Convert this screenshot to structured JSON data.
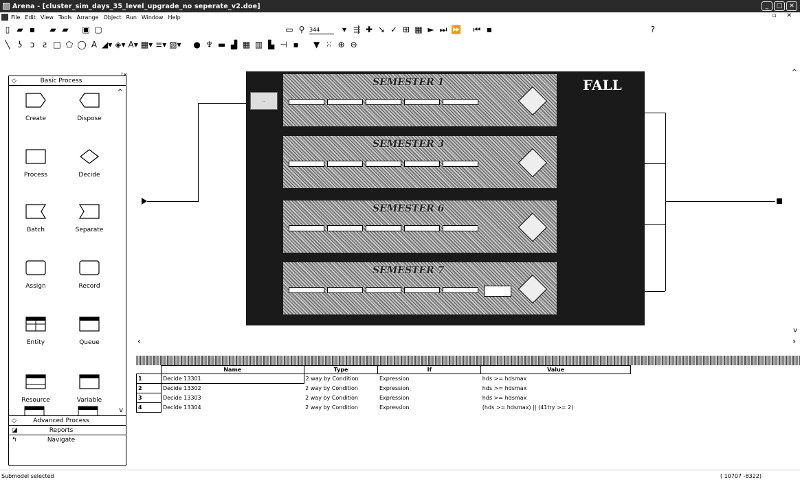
{
  "window": {
    "title": "Arena - [cluster_sim_days_35_level_upgrade_no seperate_v2.doe]"
  },
  "menubar": {
    "items": [
      "File",
      "Edit",
      "View",
      "Tools",
      "Arrange",
      "Object",
      "Run",
      "Window",
      "Help"
    ]
  },
  "toolbar": {
    "zoom_value": "344"
  },
  "project_bar": {
    "basic_process_label": "Basic Process",
    "modules": [
      {
        "label": "Create"
      },
      {
        "label": "Dispose"
      },
      {
        "label": "Process"
      },
      {
        "label": "Decide"
      },
      {
        "label": "Batch"
      },
      {
        "label": "Separate"
      },
      {
        "label": "Assign"
      },
      {
        "label": "Record"
      },
      {
        "label": "Entity"
      },
      {
        "label": "Queue"
      },
      {
        "label": "Resource"
      },
      {
        "label": "Variable"
      }
    ],
    "advanced_process_label": "Advanced Process",
    "reports_label": "Reports",
    "navigate_label": "Navigate"
  },
  "canvas": {
    "submodel_label": "FALL",
    "semesters": [
      {
        "title": "SEMESTER 1"
      },
      {
        "title": "SEMESTER 3"
      },
      {
        "title": "SEMESTER 6"
      },
      {
        "title": "SEMESTER 7"
      }
    ]
  },
  "spreadsheet": {
    "columns": [
      "Name",
      "Type",
      "If",
      "Value"
    ],
    "rows": [
      {
        "num": "1",
        "name": "Decide 13301",
        "type": "2 way by Condition",
        "if": "Expression",
        "value": "hds >= hdsmax"
      },
      {
        "num": "2",
        "name": "Decide 13302",
        "type": "2 way by Condition",
        "if": "Expression",
        "value": "hds >= hdsmax"
      },
      {
        "num": "3",
        "name": "Decide 13303",
        "type": "2 way by Condition",
        "if": "Expression",
        "value": "hds >= hdsmax"
      },
      {
        "num": "4",
        "name": "Decide 13304",
        "type": "2 way by Condition",
        "if": "Expression",
        "value": "(hds >= hdsmax) || (41try >= 2)"
      }
    ]
  },
  "statusbar": {
    "message": "Submodel selected",
    "coordinates": "( 10707  -8322)"
  }
}
